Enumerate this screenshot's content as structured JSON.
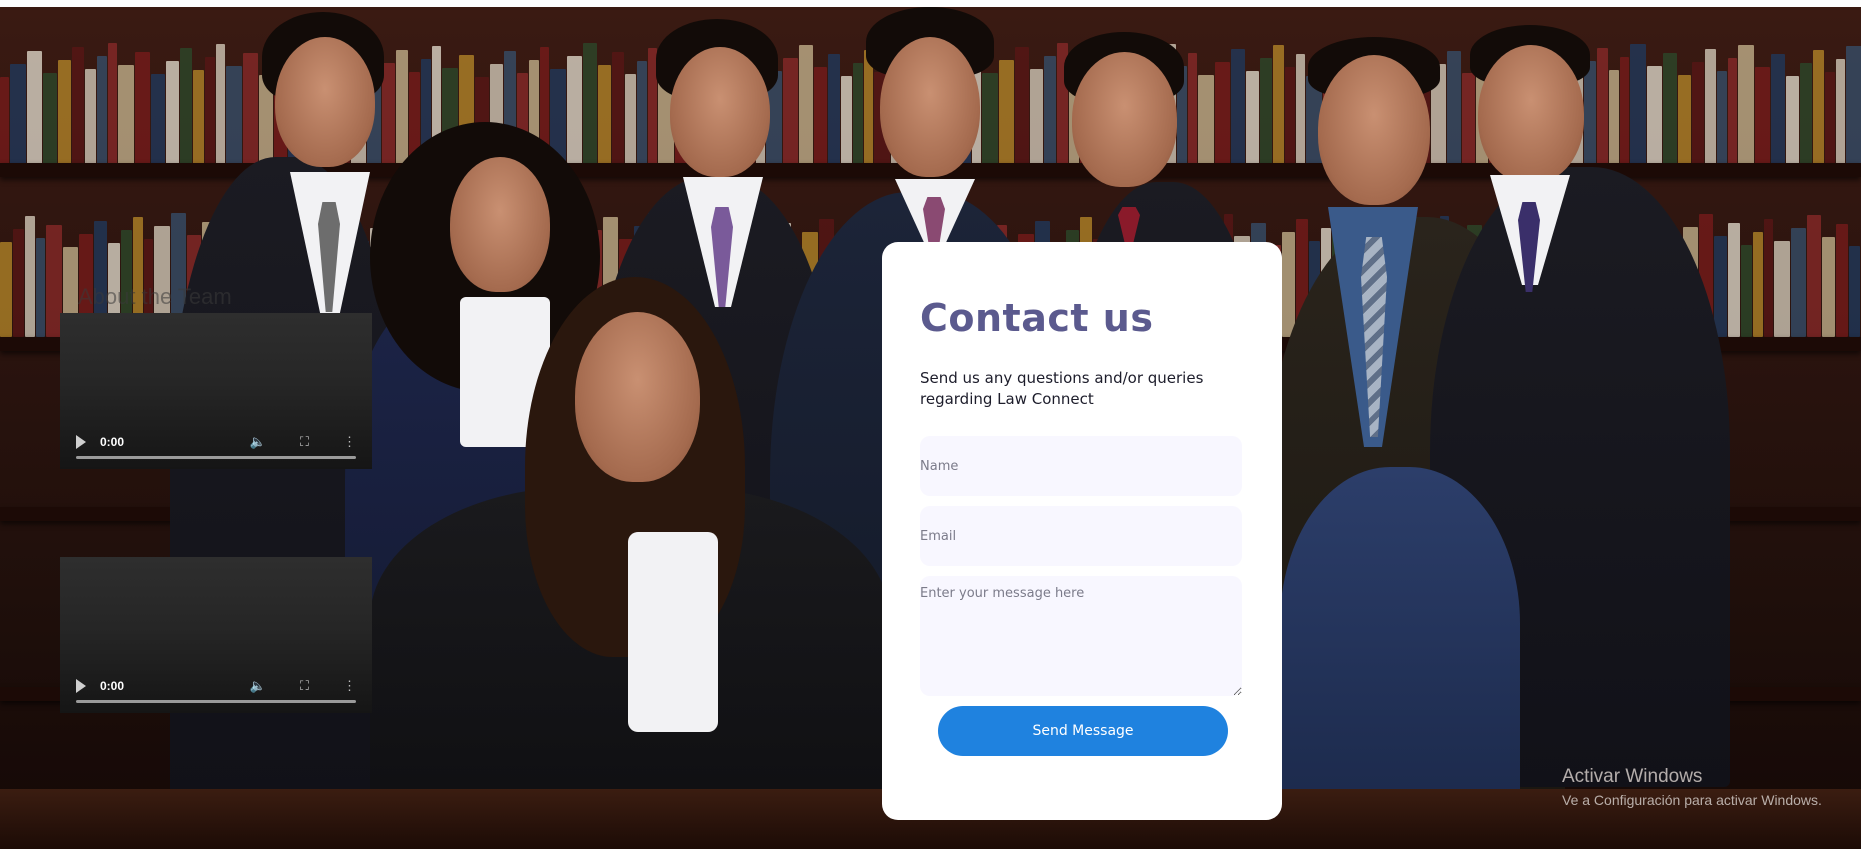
{
  "left": {
    "about_title": "About the Team",
    "second_title": "",
    "videos": [
      {
        "time": "0:00"
      },
      {
        "time": "0:00"
      }
    ]
  },
  "contact": {
    "title": "Contact us",
    "subtitle": "Send us any questions and/or queries regarding Law Connect",
    "name_placeholder": "Name",
    "email_placeholder": "Email",
    "message_placeholder": "Enter your message here",
    "send_label": "Send Message"
  },
  "watermark": {
    "title": "Activar Windows",
    "subtitle": "Ve a Configuración para activar Windows."
  },
  "colors": {
    "title": "#5b5a8e",
    "button": "#1f82df",
    "field_bg": "#f8f7ff"
  }
}
